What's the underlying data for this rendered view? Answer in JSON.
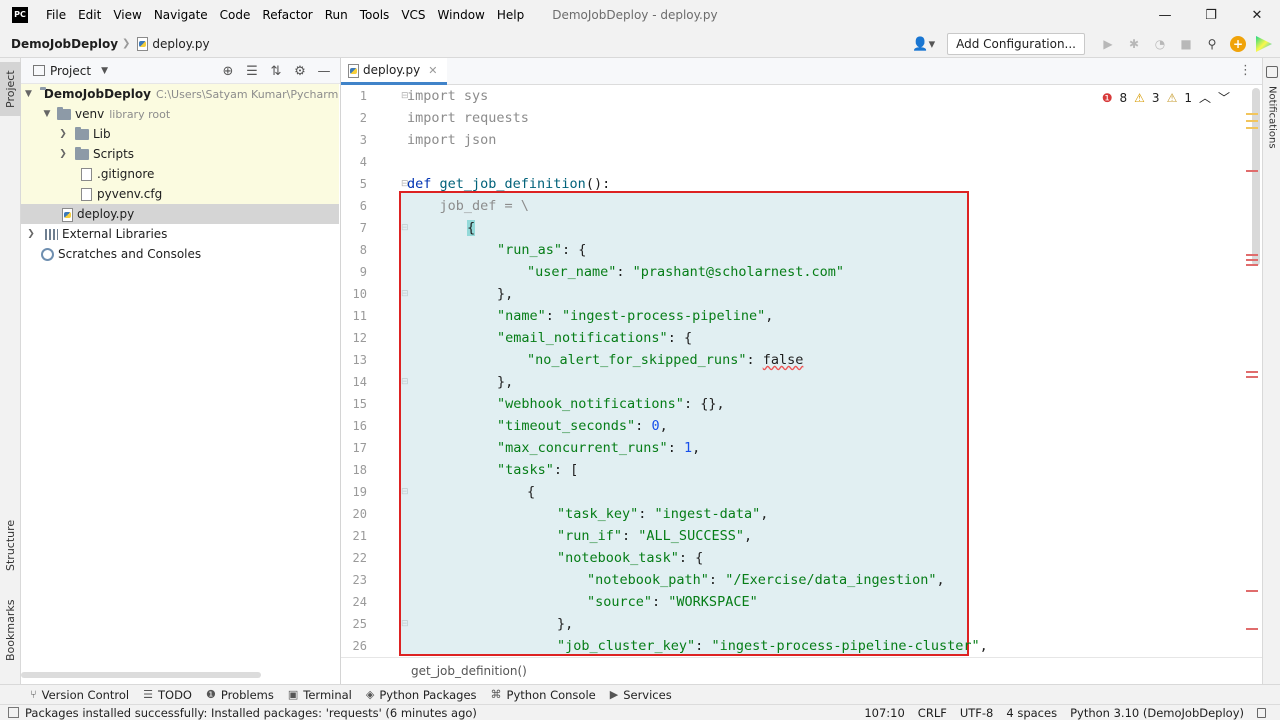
{
  "app": {
    "logo": "PC",
    "menu": [
      "File",
      "Edit",
      "View",
      "Navigate",
      "Code",
      "Refactor",
      "Run",
      "Tools",
      "VCS",
      "Window",
      "Help"
    ],
    "window_title": "DemoJobDeploy - deploy.py",
    "controls": {
      "minimize": "—",
      "maximize": "❐",
      "close": "✕"
    }
  },
  "navbar": {
    "project": "DemoJobDeploy",
    "file": "deploy.py",
    "add_config": "Add Configuration..."
  },
  "left_tabs": {
    "project": "Project",
    "structure": "Structure",
    "bookmarks": "Bookmarks"
  },
  "project_panel": {
    "title": "Project",
    "tree": [
      {
        "name": "DemoJobDeploy",
        "note": "C:\\Users\\Satyam Kumar\\PycharmProje"
      },
      {
        "name": "venv",
        "note": "library root"
      },
      {
        "name": "Lib"
      },
      {
        "name": "Scripts"
      },
      {
        "name": ".gitignore"
      },
      {
        "name": "pyvenv.cfg"
      },
      {
        "name": "deploy.py"
      },
      {
        "name": "External Libraries"
      },
      {
        "name": "Scratches and Consoles"
      }
    ]
  },
  "editor": {
    "tab": "deploy.py",
    "inspections": {
      "errors": "8",
      "warnings": "3",
      "weak": "1"
    },
    "line_numbers": [
      "1",
      "2",
      "3",
      "4",
      "5",
      "6",
      "7",
      "8",
      "9",
      "10",
      "11",
      "12",
      "13",
      "14",
      "15",
      "16",
      "17",
      "18",
      "19",
      "20",
      "21",
      "22",
      "23",
      "24",
      "25",
      "26"
    ],
    "code": {
      "l1": "import sys",
      "l2": "import requests",
      "l3": "import json",
      "l5_kw": "def ",
      "l5_fn": "get_job_definition",
      "l5_rest": "():",
      "l6": "    job_def = \\",
      "l7": "{",
      "l8_key": "\"run_as\"",
      "l8_rest": ": {",
      "l9_key": "\"user_name\"",
      "l9_val": "\"prashant@scholarnest.com\"",
      "l10": "},",
      "l11_key": "\"name\"",
      "l11_val": "\"ingest-process-pipeline\"",
      "l12_key": "\"email_notifications\"",
      "l12_rest": ": {",
      "l13_key": "\"no_alert_for_skipped_runs\"",
      "l13_val": "false",
      "l14": "},",
      "l15_key": "\"webhook_notifications\"",
      "l15_rest": ": {},",
      "l16_key": "\"timeout_seconds\"",
      "l16_val": "0",
      "l17_key": "\"max_concurrent_runs\"",
      "l17_val": "1",
      "l18_key": "\"tasks\"",
      "l18_rest": ": [",
      "l19": "{",
      "l20_key": "\"task_key\"",
      "l20_val": "\"ingest-data\"",
      "l21_key": "\"run_if\"",
      "l21_val": "\"ALL_SUCCESS\"",
      "l22_key": "\"notebook_task\"",
      "l22_rest": ": {",
      "l23_key": "\"notebook_path\"",
      "l23_val": "\"/Exercise/data_ingestion\"",
      "l24_key": "\"source\"",
      "l24_val": "\"WORKSPACE\"",
      "l25": "},",
      "l26_key": "\"job_cluster_key\"",
      "l26_val": "\"ingest-process-pipeline-cluster\""
    },
    "breadcrumb": "get_job_definition()"
  },
  "right_tabs": {
    "notifications": "Notifications"
  },
  "bottom_tools": [
    "Version Control",
    "TODO",
    "Problems",
    "Terminal",
    "Python Packages",
    "Python Console",
    "Services"
  ],
  "status": {
    "message": "Packages installed successfully: Installed packages: 'requests' (6 minutes ago)",
    "position": "107:10",
    "line_sep": "CRLF",
    "encoding": "UTF-8",
    "indent": "4 spaces",
    "interpreter": "Python 3.10 (DemoJobDeploy)"
  }
}
